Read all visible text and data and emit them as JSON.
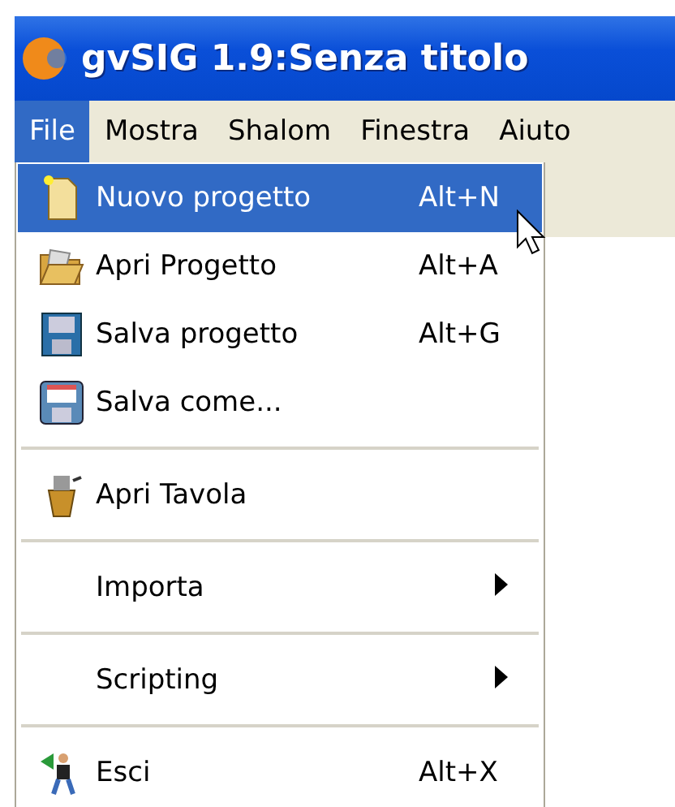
{
  "window": {
    "title": "gvSIG 1.9:Senza titolo"
  },
  "menubar": [
    {
      "label": "File",
      "selected": true
    },
    {
      "label": "Mostra",
      "selected": false
    },
    {
      "label": "Shalom",
      "selected": false
    },
    {
      "label": "Finestra",
      "selected": false
    },
    {
      "label": "Aiuto",
      "selected": false
    }
  ],
  "menu": [
    {
      "kind": "command",
      "label": "Nuovo progetto",
      "shortcut": "Alt+N",
      "selected": true
    },
    {
      "kind": "command",
      "label": "Apri Progetto",
      "shortcut": "Alt+A",
      "selected": false
    },
    {
      "kind": "command",
      "label": "Salva progetto",
      "shortcut": "Alt+G",
      "selected": false
    },
    {
      "kind": "command",
      "label": "Salva come...",
      "selected": false
    },
    {
      "kind": "separator"
    },
    {
      "kind": "command",
      "label": "Apri Tavola",
      "selected": false
    },
    {
      "kind": "separator"
    },
    {
      "kind": "submenu",
      "label": "Importa",
      "selected": false
    },
    {
      "kind": "separator"
    },
    {
      "kind": "submenu",
      "label": "Scripting",
      "selected": false
    },
    {
      "kind": "separator"
    },
    {
      "kind": "command",
      "label": "Esci",
      "shortcut": "Alt+X",
      "selected": false
    }
  ]
}
